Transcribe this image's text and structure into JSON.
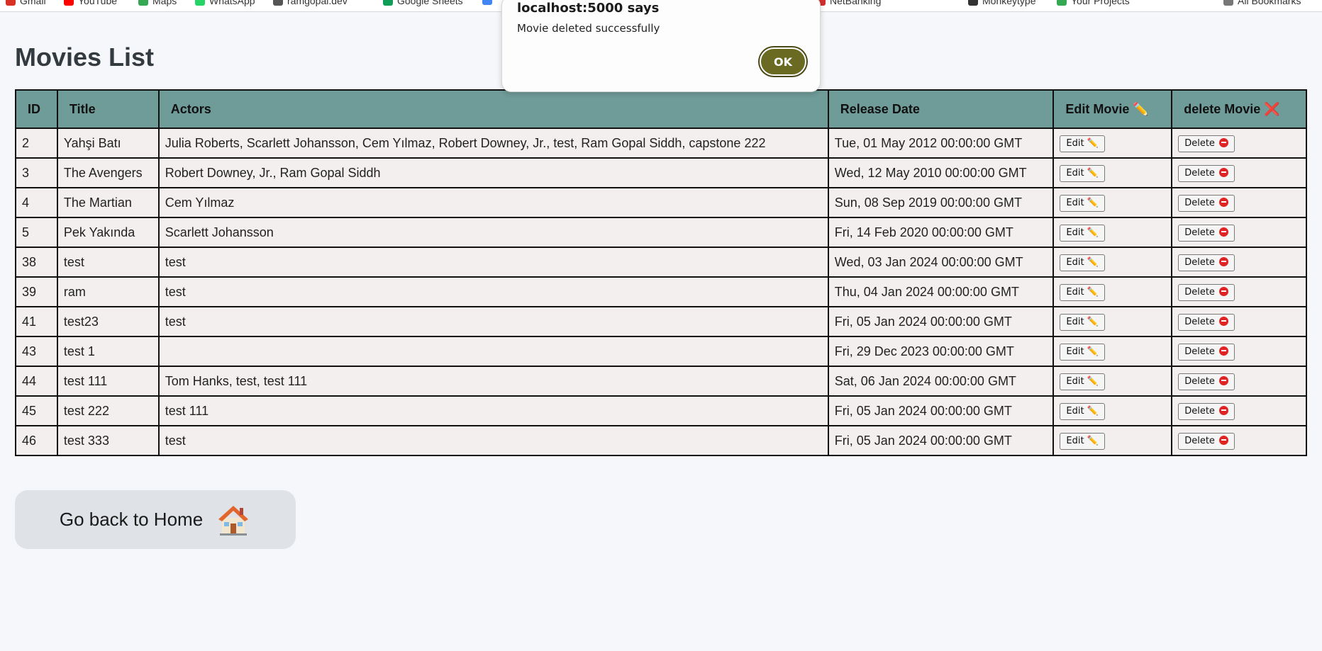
{
  "bookmarks": [
    {
      "label": "Gmail",
      "color": "#d93025"
    },
    {
      "label": "YouTube",
      "color": "#ff0000"
    },
    {
      "label": "Maps",
      "color": "#34a853"
    },
    {
      "label": "WhatsApp",
      "color": "#25d366"
    },
    {
      "label": "ramgopal.dev",
      "color": "#555555"
    },
    {
      "label": "Google Sheets",
      "color": "#0f9d58"
    },
    {
      "label": "",
      "color": "#4285f4"
    },
    {
      "label": "NetBanking",
      "color": "#d32f2f"
    },
    {
      "label": "Monkeytype",
      "color": "#333333"
    },
    {
      "label": "Your Projects",
      "color": "#34a853"
    },
    {
      "label": "All Bookmarks",
      "color": "#777777"
    }
  ],
  "page": {
    "title": "Movies List"
  },
  "table": {
    "headers": {
      "id": "ID",
      "title": "Title",
      "actors": "Actors",
      "release_date": "Release Date",
      "edit": "Edit Movie ✏️",
      "delete": "delete Movie ❌"
    },
    "edit_label": "Edit ✏️",
    "delete_label": "Delete",
    "rows": [
      {
        "id": "2",
        "title": "Yahşi Batı",
        "actors": "Julia Roberts, Scarlett Johansson, Cem Yılmaz, Robert Downey, Jr., test, Ram Gopal Siddh, capstone 222",
        "release_date": "Tue, 01 May 2012 00:00:00 GMT"
      },
      {
        "id": "3",
        "title": "The Avengers",
        "actors": "Robert Downey, Jr., Ram Gopal Siddh",
        "release_date": "Wed, 12 May 2010 00:00:00 GMT"
      },
      {
        "id": "4",
        "title": "The Martian",
        "actors": "Cem Yılmaz",
        "release_date": "Sun, 08 Sep 2019 00:00:00 GMT"
      },
      {
        "id": "5",
        "title": "Pek Yakında",
        "actors": "Scarlett Johansson",
        "release_date": "Fri, 14 Feb 2020 00:00:00 GMT"
      },
      {
        "id": "38",
        "title": "test",
        "actors": "test",
        "release_date": "Wed, 03 Jan 2024 00:00:00 GMT"
      },
      {
        "id": "39",
        "title": "ram",
        "actors": "test",
        "release_date": "Thu, 04 Jan 2024 00:00:00 GMT"
      },
      {
        "id": "41",
        "title": "test23",
        "actors": "test",
        "release_date": "Fri, 05 Jan 2024 00:00:00 GMT"
      },
      {
        "id": "43",
        "title": "test 1",
        "actors": "",
        "release_date": "Fri, 29 Dec 2023 00:00:00 GMT"
      },
      {
        "id": "44",
        "title": "test 111",
        "actors": "Tom Hanks, test, test 111",
        "release_date": "Sat, 06 Jan 2024 00:00:00 GMT"
      },
      {
        "id": "45",
        "title": "test 222",
        "actors": "test 111",
        "release_date": "Fri, 05 Jan 2024 00:00:00 GMT"
      },
      {
        "id": "46",
        "title": "test 333",
        "actors": "test",
        "release_date": "Fri, 05 Jan 2024 00:00:00 GMT"
      }
    ]
  },
  "home_button": {
    "label": "Go back to Home",
    "icon": "house-icon"
  },
  "dialog": {
    "title": "localhost:5000 says",
    "message": "Movie deleted successfully",
    "ok_label": "OK"
  },
  "colors": {
    "header_bg": "#6f9b98",
    "row_bg": "#f3efee",
    "ok_button": "#6b6a23",
    "page_bg": "#f5f7fa"
  }
}
